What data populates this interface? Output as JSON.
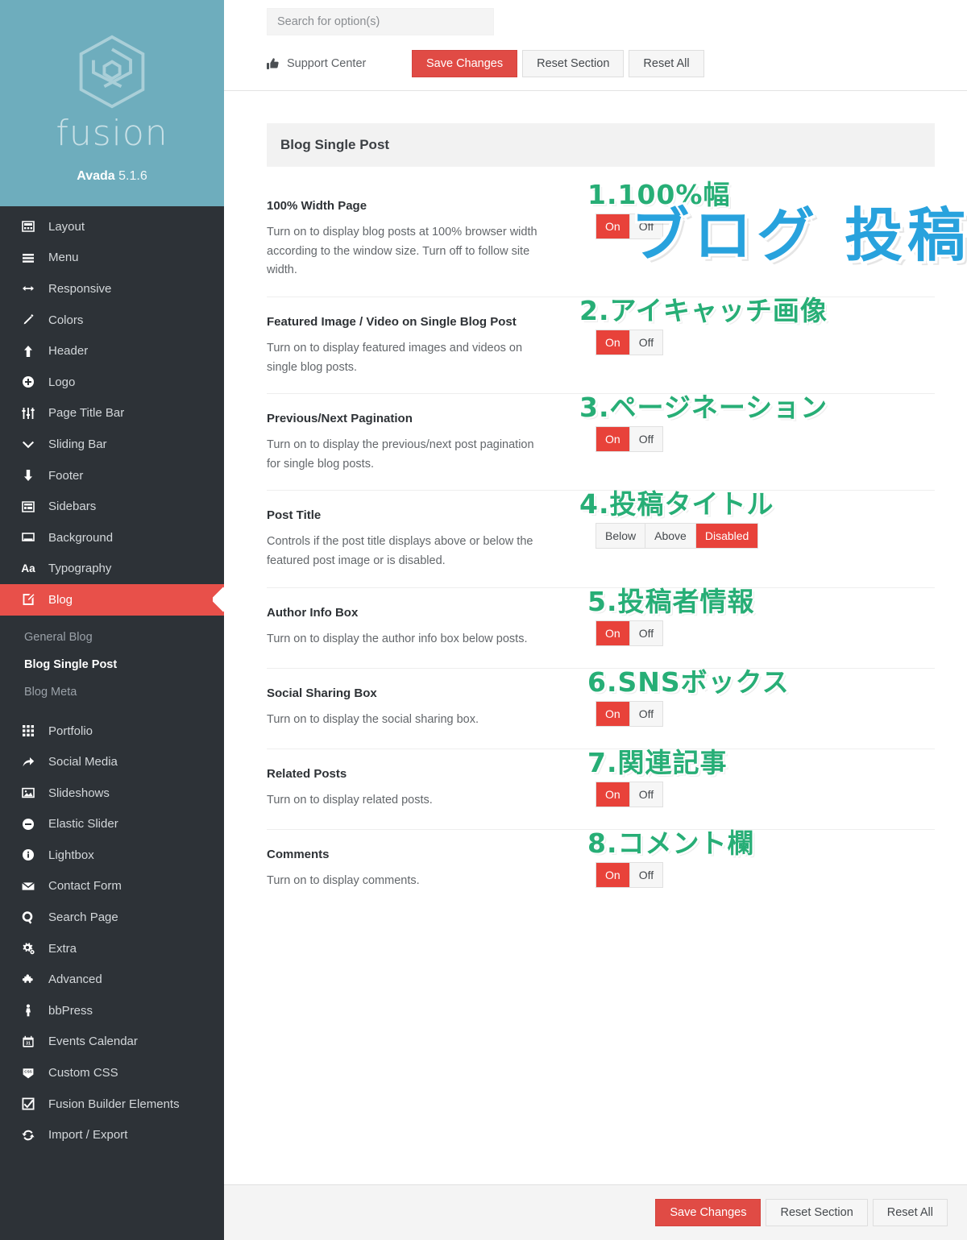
{
  "brand": {
    "logo_icon": "fusion-hex-logo-icon",
    "wordmark": "fusion",
    "product": "Avada",
    "version": "5.1.6"
  },
  "sidebar": {
    "items": [
      {
        "label": "Layout",
        "icon": "layout-icon"
      },
      {
        "label": "Menu",
        "icon": "menu-icon"
      },
      {
        "label": "Responsive",
        "icon": "arrows-horizontal-icon"
      },
      {
        "label": "Colors",
        "icon": "brush-icon"
      },
      {
        "label": "Header",
        "icon": "arrow-up-icon"
      },
      {
        "label": "Logo",
        "icon": "plus-circle-icon"
      },
      {
        "label": "Page Title Bar",
        "icon": "sliders-icon"
      },
      {
        "label": "Sliding Bar",
        "icon": "chevron-down-icon"
      },
      {
        "label": "Footer",
        "icon": "arrow-down-icon"
      },
      {
        "label": "Sidebars",
        "icon": "sidebars-icon"
      },
      {
        "label": "Background",
        "icon": "background-icon"
      },
      {
        "label": "Typography",
        "icon": "typography-aa-icon"
      },
      {
        "label": "Blog",
        "icon": "pencil-square-icon",
        "active": true
      },
      {
        "label": "Portfolio",
        "icon": "grid-icon"
      },
      {
        "label": "Social Media",
        "icon": "share-arrow-icon"
      },
      {
        "label": "Slideshows",
        "icon": "image-icon"
      },
      {
        "label": "Elastic Slider",
        "icon": "minus-circle-icon"
      },
      {
        "label": "Lightbox",
        "icon": "info-circle-icon"
      },
      {
        "label": "Contact Form",
        "icon": "envelope-icon"
      },
      {
        "label": "Search Page",
        "icon": "search-icon"
      },
      {
        "label": "Extra",
        "icon": "gears-icon"
      },
      {
        "label": "Advanced",
        "icon": "puzzle-icon"
      },
      {
        "label": "bbPress",
        "icon": "person-icon"
      },
      {
        "label": "Events Calendar",
        "icon": "calendar-icon"
      },
      {
        "label": "Custom CSS",
        "icon": "css-badge-icon"
      },
      {
        "label": "Fusion Builder Elements",
        "icon": "checkbox-icon"
      },
      {
        "label": "Import / Export",
        "icon": "refresh-icon"
      }
    ],
    "submenu": {
      "parent": "Blog",
      "items": [
        {
          "label": "General Blog",
          "current": false
        },
        {
          "label": "Blog Single Post",
          "current": true
        },
        {
          "label": "Blog Meta",
          "current": false
        }
      ]
    }
  },
  "topbar": {
    "search_placeholder": "Search for option(s)",
    "search_value": "",
    "support_label": "Support Center",
    "support_icon": "thumbs-up-icon",
    "save_label": "Save Changes",
    "reset_section_label": "Reset Section",
    "reset_all_label": "Reset All"
  },
  "section": {
    "title": "Blog Single Post",
    "overlay_title": "ブログ 投稿ページ"
  },
  "options": [
    {
      "title": "100% Width Page",
      "desc": "Turn on to display blog posts at 100% browser width according to the window size. Turn off to follow site width.",
      "control": {
        "type": "toggle",
        "buttons": [
          "On",
          "Off"
        ],
        "selected": "On"
      },
      "annotation": "1.100%幅"
    },
    {
      "title": "Featured Image / Video on Single Blog Post",
      "desc": "Turn on to display featured images and videos on single blog posts.",
      "control": {
        "type": "toggle",
        "buttons": [
          "On",
          "Off"
        ],
        "selected": "On"
      },
      "annotation": "2.アイキャッチ画像"
    },
    {
      "title": "Previous/Next Pagination",
      "desc": "Turn on to display the previous/next post pagination for single blog posts.",
      "control": {
        "type": "toggle",
        "buttons": [
          "On",
          "Off"
        ],
        "selected": "On"
      },
      "annotation": "3.ページネーション"
    },
    {
      "title": "Post Title",
      "desc": "Controls if the post title displays above or below the featured post image or is disabled.",
      "control": {
        "type": "segmented",
        "buttons": [
          "Below",
          "Above",
          "Disabled"
        ],
        "selected": "Disabled"
      },
      "annotation": "4.投稿タイトル"
    },
    {
      "title": "Author Info Box",
      "desc": "Turn on to display the author info box below posts.",
      "control": {
        "type": "toggle",
        "buttons": [
          "On",
          "Off"
        ],
        "selected": "On"
      },
      "annotation": "5.投稿者情報"
    },
    {
      "title": "Social Sharing Box",
      "desc": "Turn on to display the social sharing box.",
      "control": {
        "type": "toggle",
        "buttons": [
          "On",
          "Off"
        ],
        "selected": "On"
      },
      "annotation": "6.SNSボックス"
    },
    {
      "title": "Related Posts",
      "desc": "Turn on to display related posts.",
      "control": {
        "type": "toggle",
        "buttons": [
          "On",
          "Off"
        ],
        "selected": "On"
      },
      "annotation": "7.関連記事"
    },
    {
      "title": "Comments",
      "desc": "Turn on to display comments.",
      "control": {
        "type": "toggle",
        "buttons": [
          "On",
          "Off"
        ],
        "selected": "On"
      },
      "annotation": "8.コメント欄"
    }
  ],
  "footer": {
    "save_label": "Save Changes",
    "reset_section_label": "Reset Section",
    "reset_all_label": "Reset All"
  },
  "colors": {
    "brand_teal": "#6eadbd",
    "sidebar_dark": "#2d3237",
    "accent_red": "#e8504a",
    "annotation_green": "#27ae76",
    "title_blue": "#28a2dd"
  }
}
